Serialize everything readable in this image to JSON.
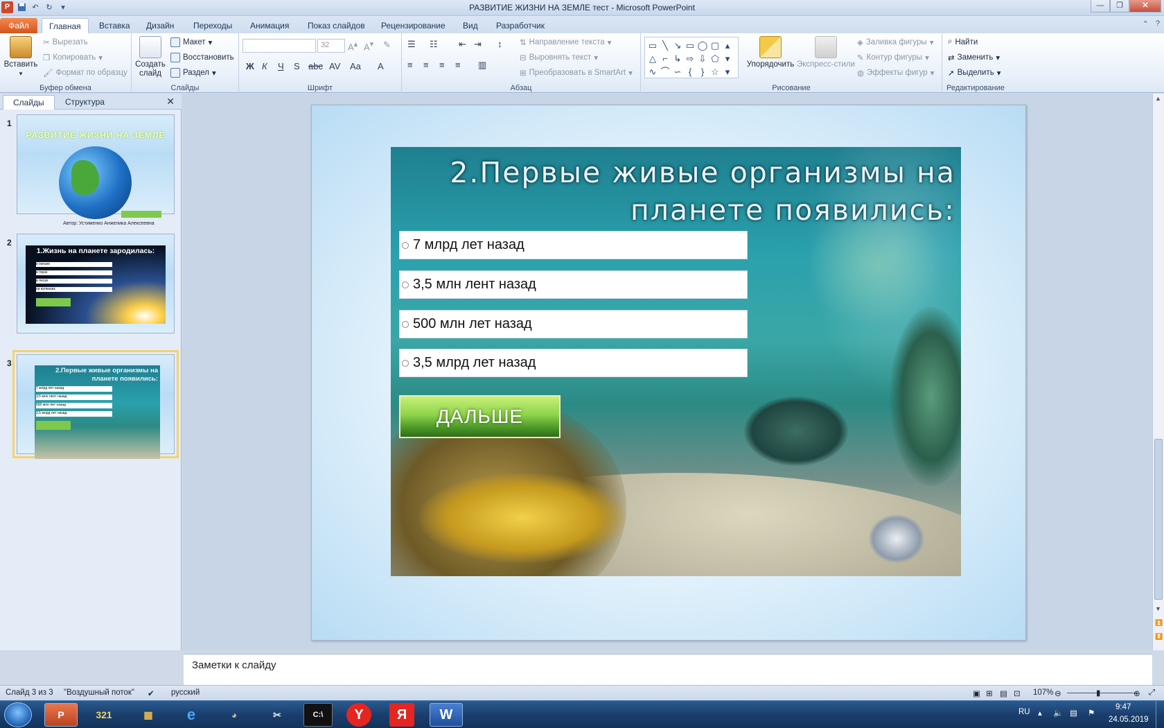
{
  "window": {
    "title": "РАЗВИТИЕ ЖИЗНИ НА ЗЕМЛЕ тест  -  Microsoft PowerPoint",
    "app_icon": "P",
    "controls": [
      "minimize-icon",
      "maximize-icon",
      "close-icon"
    ]
  },
  "tabs": [
    "Файл",
    "Главная",
    "Вставка",
    "Дизайн",
    "Переходы",
    "Анимация",
    "Показ слайдов",
    "Рецензирование",
    "Вид",
    "Разработчик"
  ],
  "ribbon": {
    "clipboard": {
      "label": "Буфер обмена",
      "paste": "Вставить",
      "cut": "Вырезать",
      "copy": "Копировать",
      "format_painter": "Формат по образцу"
    },
    "slides": {
      "label": "Слайды",
      "new_slide": "Создать слайд",
      "layout": "Макет",
      "reset": "Восстановить",
      "section": "Раздел"
    },
    "font": {
      "label": "Шрифт",
      "size": "32"
    },
    "paragraph": {
      "label": "Абзац",
      "text_direction": "Направление текста",
      "align_text": "Выровнять текст",
      "convert_smartart": "Преобразовать в SmartArt"
    },
    "drawing": {
      "label": "Рисование",
      "arrange": "Упорядочить",
      "quick_styles": "Экспресс-стили",
      "shape_fill": "Заливка фигуры",
      "shape_outline": "Контур фигуры",
      "shape_effects": "Эффекты фигур"
    },
    "editing": {
      "label": "Редактирование",
      "find": "Найти",
      "replace": "Заменить",
      "select": "Выделить"
    }
  },
  "panel": {
    "tab_slides": "Слайды",
    "tab_outline": "Структура",
    "thumbs": [
      {
        "num": "1",
        "title": "РАЗВИТИЕ ЖИЗНИ НА ЗЕМЛЕ",
        "author": "Автор: Устименко Анжелика Алексеевна"
      },
      {
        "num": "2",
        "title": "1.Жизнь на планете зародилась:",
        "items": [
          "в океане",
          "в горах",
          "в лесах",
          "на вулканах"
        ]
      },
      {
        "num": "3",
        "title": "2.Первые живые организмы на планете появились:",
        "items": [
          "7 млрд лет назад",
          "3,5 млн лент назад",
          "500 млн лет назад",
          "3,5 млрд лет назад"
        ]
      }
    ],
    "selected_index": 3
  },
  "slide": {
    "question": "2.Первые живые организмы на планете появились:",
    "options": [
      "7 млрд лет назад",
      "3,5 млн лент назад",
      "500 млн лет назад",
      "3,5 млрд лет назад"
    ],
    "next_button": "ДАЛЬШЕ"
  },
  "notes": {
    "placeholder": "Заметки к слайду"
  },
  "status": {
    "slide_info": "Слайд 3 из 3",
    "theme": "\"Воздушный поток\"",
    "language": "русский",
    "zoom": "107%"
  },
  "taskbar": {
    "apps": [
      "windows-start",
      "powerpoint",
      "media-player-classic",
      "winrar",
      "internet-explorer",
      "gimp",
      "snipping-tool",
      "command-prompt",
      "yandex-browser",
      "yandex",
      "word"
    ],
    "lang": "RU",
    "time": "9:47",
    "date": "24.05.2019"
  },
  "colors": {
    "file_tab": "#d4551c",
    "accent": "#2b5797",
    "slide_bg": "#b8dcf4",
    "button_green": "#4f9c2a"
  }
}
